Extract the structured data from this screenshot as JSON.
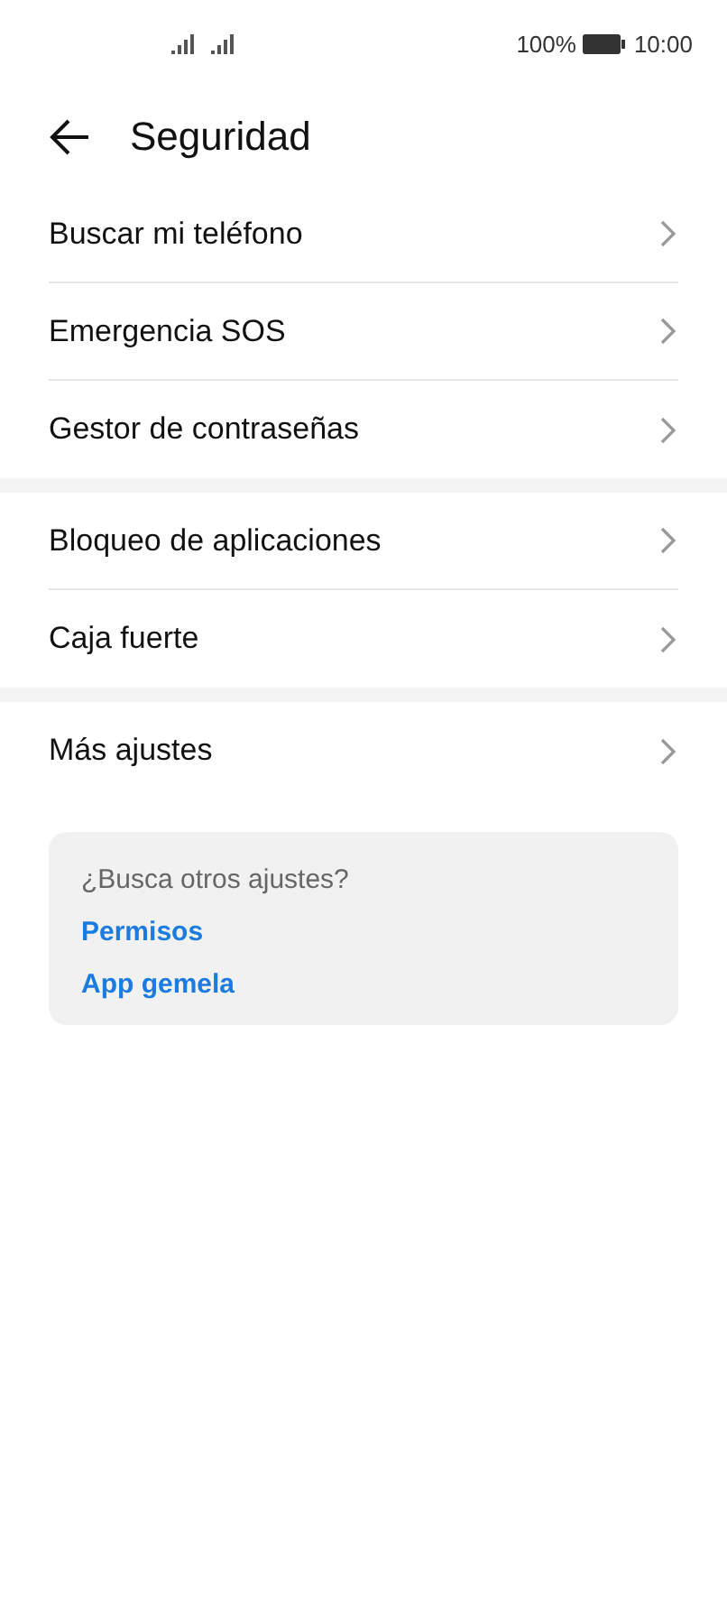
{
  "status_bar": {
    "battery": "100%",
    "time": "10:00"
  },
  "header": {
    "title": "Seguridad"
  },
  "groups": [
    {
      "items": [
        {
          "label": "Buscar mi teléfono"
        },
        {
          "label": "Emergencia SOS"
        },
        {
          "label": "Gestor de contraseñas"
        }
      ]
    },
    {
      "items": [
        {
          "label": "Bloqueo de aplicaciones"
        },
        {
          "label": "Caja fuerte"
        }
      ]
    },
    {
      "items": [
        {
          "label": "Más ajustes"
        }
      ]
    }
  ],
  "suggestions": {
    "title": "¿Busca otros ajustes?",
    "links": [
      "Permisos",
      "App gemela"
    ]
  }
}
